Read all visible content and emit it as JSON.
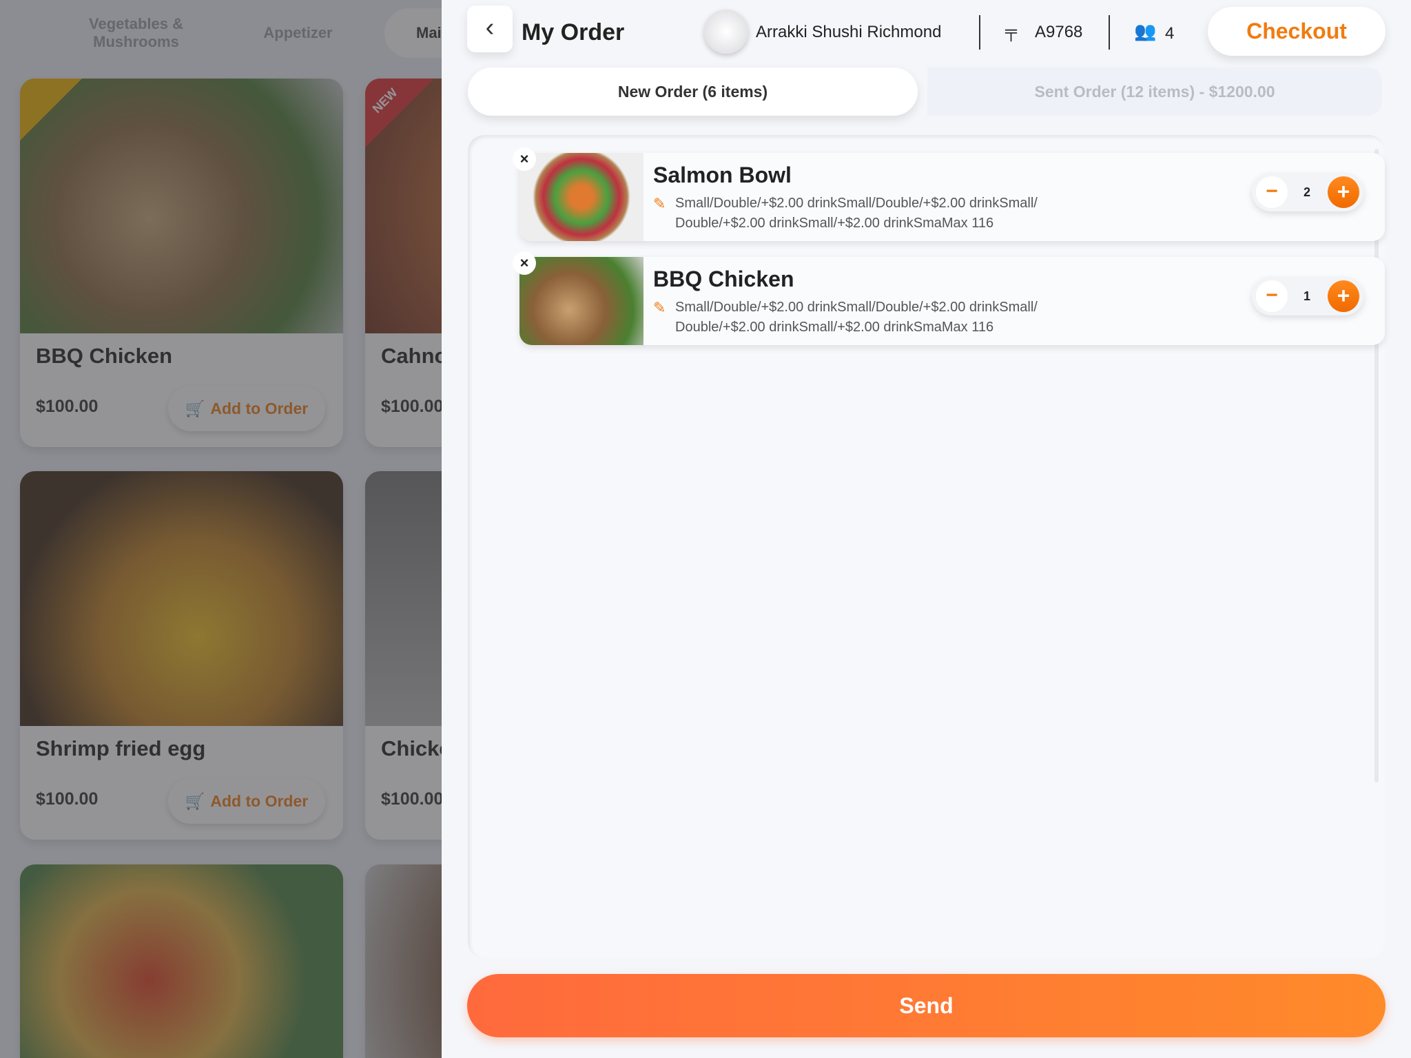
{
  "menu": {
    "categories": [
      "Vegetables & Mushrooms",
      "Appetizer",
      "Mai"
    ],
    "add_label": "Add to Order",
    "cards": [
      {
        "name": "BBQ Chicken",
        "price": "$100.00",
        "badge": "thumbs-up-icon"
      },
      {
        "name": "Cahno",
        "price": "$100.00",
        "badge": "NEW"
      },
      {
        "name": "Shrimp fried egg",
        "price": "$100.00"
      },
      {
        "name": "Chicke",
        "price": "$100.00"
      }
    ]
  },
  "header": {
    "title": "My Order",
    "restaurant": "Arrakki Shushi Richmond",
    "table": "A9768",
    "guests": "4",
    "checkout": "Checkout"
  },
  "tabs": {
    "new": "New Order (6 items)",
    "sent": "Sent Order (12 items) - $1200.00"
  },
  "items": [
    {
      "name": "Salmon Bowl",
      "detail1": "Small/Double/+$2.00 drinkSmall/Double/+$2.00 drinkSmall/",
      "detail2": "Double/+$2.00 drinkSmall/+$2.00 drinkSmaMax 116",
      "qty": "2"
    },
    {
      "name": "BBQ Chicken",
      "detail1": "Small/Double/+$2.00 drinkSmall/Double/+$2.00 drinkSmall/",
      "detail2": "Double/+$2.00 drinkSmall/+$2.00 drinkSmaMax 116",
      "qty": "1"
    }
  ],
  "send": "Send",
  "colors": {
    "accent": "#f07c10",
    "send_start": "#ff6a3d",
    "send_end": "#ff8a2a"
  }
}
